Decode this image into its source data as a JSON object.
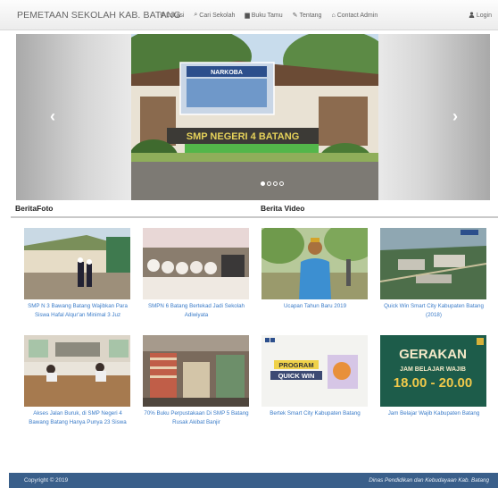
{
  "navbar": {
    "brand": "PEMETAAN SEKOLAH KAB. BATANG",
    "items": [
      {
        "icon": "map-marker-icon",
        "glyph": "⚲",
        "label": "Lokasi"
      },
      {
        "icon": "search-icon",
        "glyph": "⌕",
        "label": "Cari Sekolah"
      },
      {
        "icon": "book-icon",
        "glyph": "▆",
        "label": "Buku Tamu"
      },
      {
        "icon": "pencil-icon",
        "glyph": "✎",
        "label": "Tentang"
      },
      {
        "icon": "home-icon",
        "glyph": "⌂",
        "label": "Contact Admin"
      }
    ],
    "login": {
      "icon": "user-icon",
      "glyph": "👤",
      "label": "Login"
    }
  },
  "carousel": {
    "prev": "‹",
    "next": "›",
    "slide_count": 4,
    "active_slide": 1,
    "sign_banner": "NARKOBA",
    "school_sign": "SMP NEGERI 4 BATANG"
  },
  "sections": {
    "photo_news": "BeritaFoto",
    "video_news": "Berita Video"
  },
  "gallery": [
    {
      "caption": "SMP N 3 Bawang Batang Wajibkan Para Siswa Hafal Alqur'an Minimal 3 Juz"
    },
    {
      "caption": "SMPN 6 Batang Bertekad Jadi Sekolah Adiwiyata"
    },
    {
      "caption": "Ucapan Tahun Baru 2019"
    },
    {
      "caption": "Quick Win Smart City Kabupaten Batang (2018)"
    },
    {
      "caption": "Akses Jalan Buruk, di SMP Negeri 4 Bawang Batang Hanya Punya 23 Siswa"
    },
    {
      "caption": "70% Buku Perpustakaan Di SMP 5 Batang Rusak Akibat Banjir"
    },
    {
      "caption": "Bertek Smart City Kabupaten Batang",
      "overlay": [
        "PROGRAM",
        "QUICK WIN"
      ]
    },
    {
      "caption": "Jam Belajar Wajib Kabupaten Batang",
      "overlay": [
        "GERAKAN",
        "JAM BELAJAR WAJIB",
        "18.00 - 20.00"
      ]
    }
  ],
  "footer": {
    "copyright": "Copyright © 2019",
    "organization": "Dinas Pendidikan dan Kebudayaan Kab. Batang"
  },
  "colors": {
    "footer_bg": "#3a5f8a",
    "caption_link": "#3a7bc8"
  }
}
